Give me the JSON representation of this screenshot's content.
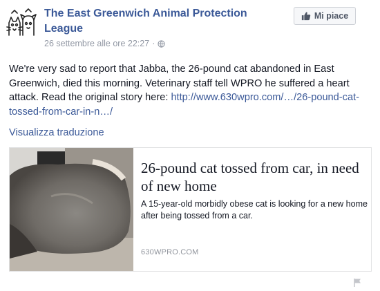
{
  "page": {
    "name": "The East Greenwich Animal Protection League"
  },
  "post": {
    "timestamp": "26 settembre alle ore 22:27",
    "separator": "·",
    "privacy_icon": "globe-icon",
    "text_before_link": "We're very sad to report that Jabba, the 26-pound cat abandoned in East Greenwich, died this morning. Veterinary staff tell WPRO he suffered a heart attack. Read the original story here: ",
    "link_text": "http://www.630wpro.com/…/26-pound-cat-tossed-from-car-in-n…/",
    "translate_label": "Visualizza traduzione"
  },
  "like_button": {
    "label": "Mi piace",
    "icon": "thumbs-up-icon"
  },
  "link_card": {
    "title": "26-pound cat tossed from car, in need of new home",
    "description": "A 15-year-old morbidly obese cat is looking for a new home after being tossed from a car.",
    "domain": "630WPRO.COM"
  },
  "icons": {
    "report": "flag-icon"
  },
  "colors": {
    "link": "#3b5998",
    "text": "#141823",
    "meta": "#9197a3"
  }
}
